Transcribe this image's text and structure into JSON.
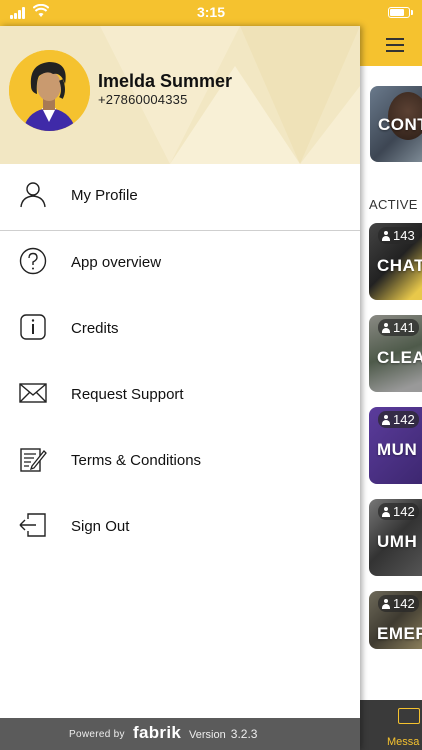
{
  "status_bar": {
    "time": "3:15",
    "battery_level": 0.8
  },
  "user": {
    "name": "Imelda Summer",
    "phone": "+27860004335"
  },
  "menu": [
    {
      "label": "My Profile",
      "icon": "user-icon"
    },
    {
      "label": "App overview",
      "icon": "question-circle-icon"
    },
    {
      "label": "Credits",
      "icon": "info-icon"
    },
    {
      "label": "Request Support",
      "icon": "envelope-icon"
    },
    {
      "label": "Terms & Conditions",
      "icon": "edit-document-icon"
    },
    {
      "label": "Sign Out",
      "icon": "sign-out-icon"
    }
  ],
  "footer": {
    "powered_by": "Powered by",
    "brand": "fabrik",
    "version_label": "Version",
    "version": "3.2.3"
  },
  "main": {
    "featured_card_title": "CONT",
    "section_label": "ACTIVE",
    "groups": [
      {
        "count": "143",
        "title": "CHAT"
      },
      {
        "count": "141",
        "title": "CLEA"
      },
      {
        "count": "142",
        "title": "MUN"
      },
      {
        "count": "142",
        "title": "UMH"
      },
      {
        "count": "142",
        "title": "EMEF"
      }
    ],
    "bottom_tab_label": "Messa"
  },
  "colors": {
    "accent": "#f5c22f",
    "header_bg": "#f2e7c3",
    "footer_bg": "#5b5b5b",
    "purple": "#4a2f8a"
  }
}
